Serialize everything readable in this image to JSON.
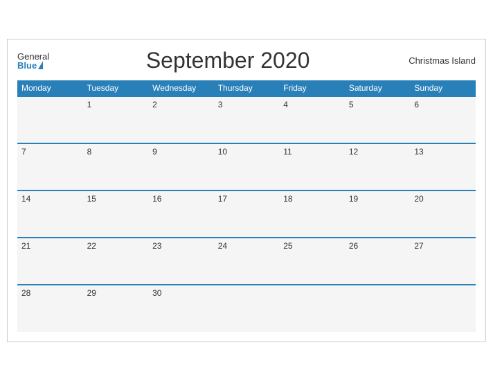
{
  "header": {
    "logo_general": "General",
    "logo_blue": "Blue",
    "title": "September 2020",
    "location": "Christmas Island"
  },
  "days_of_week": [
    "Monday",
    "Tuesday",
    "Wednesday",
    "Thursday",
    "Friday",
    "Saturday",
    "Sunday"
  ],
  "weeks": [
    [
      "",
      "1",
      "2",
      "3",
      "4",
      "5",
      "6"
    ],
    [
      "7",
      "8",
      "9",
      "10",
      "11",
      "12",
      "13"
    ],
    [
      "14",
      "15",
      "16",
      "17",
      "18",
      "19",
      "20"
    ],
    [
      "21",
      "22",
      "23",
      "24",
      "25",
      "26",
      "27"
    ],
    [
      "28",
      "29",
      "30",
      "",
      "",
      "",
      ""
    ]
  ]
}
